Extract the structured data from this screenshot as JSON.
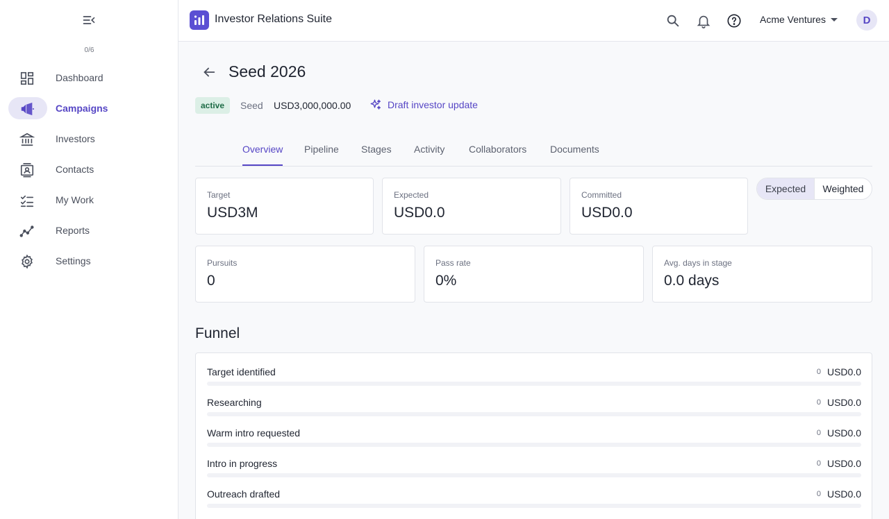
{
  "sidebar": {
    "counter": "0/6",
    "items": [
      {
        "label": "Dashboard",
        "icon": "dashboard-icon"
      },
      {
        "label": "Campaigns",
        "icon": "megaphone-icon",
        "active": true
      },
      {
        "label": "Investors",
        "icon": "bank-icon"
      },
      {
        "label": "Contacts",
        "icon": "contact-card-icon"
      },
      {
        "label": "My Work",
        "icon": "checklist-icon"
      },
      {
        "label": "Reports",
        "icon": "trend-icon"
      },
      {
        "label": "Settings",
        "icon": "gear-icon"
      }
    ]
  },
  "header": {
    "app_title": "Investor Relations Suite",
    "org_name": "Acme Ventures",
    "avatar_initial": "D"
  },
  "campaign": {
    "title": "Seed 2026",
    "status": "active",
    "stage": "Seed",
    "amount": "USD3,000,000.00",
    "draft_action": "Draft investor update"
  },
  "tabs": [
    "Overview",
    "Pipeline",
    "Stages",
    "Activity",
    "Collaborators",
    "Documents"
  ],
  "active_tab": "Overview",
  "metrics": {
    "target": {
      "label": "Target",
      "value": "USD3M"
    },
    "expected": {
      "label": "Expected",
      "value": "USD0.0"
    },
    "committed": {
      "label": "Committed",
      "value": "USD0.0"
    },
    "pursuits": {
      "label": "Pursuits",
      "value": "0"
    },
    "pass_rate": {
      "label": "Pass rate",
      "value": "0%"
    },
    "avg_days": {
      "label": "Avg. days in stage",
      "value": "0.0 days"
    }
  },
  "view_toggle": {
    "options": [
      "Expected",
      "Weighted"
    ],
    "selected": "Expected"
  },
  "funnel": {
    "title": "Funnel",
    "rows": [
      {
        "stage": "Target identified",
        "count": "0",
        "value": "USD0.0",
        "progress": 0
      },
      {
        "stage": "Researching",
        "count": "0",
        "value": "USD0.0",
        "progress": 0
      },
      {
        "stage": "Warm intro requested",
        "count": "0",
        "value": "USD0.0",
        "progress": 0
      },
      {
        "stage": "Intro in progress",
        "count": "0",
        "value": "USD0.0",
        "progress": 0
      },
      {
        "stage": "Outreach drafted",
        "count": "0",
        "value": "USD0.0",
        "progress": 0
      }
    ]
  },
  "colors": {
    "accent": "#5646c5",
    "logo": "#5b4fd3",
    "active_pill": "#e7e6f6",
    "badge_bg": "#dcefe6",
    "badge_text": "#1d6b46"
  }
}
